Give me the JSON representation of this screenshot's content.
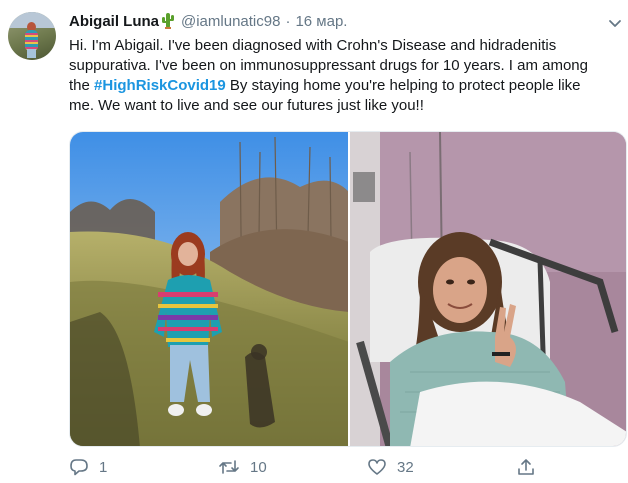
{
  "tweet": {
    "author_name": "Abigail Luna",
    "author_emoji": "cactus-emoji",
    "handle": "@iamlunatic98",
    "separator": "·",
    "date": "16 мар.",
    "text_before_hashtag": "Hi. I'm Abigail. I've been diagnosed with Crohn's Disease and hidradenitis suppurativa. I've been on immunosuppressant drugs for 10 years. I am among the ",
    "hashtag": "#HighRiskCovid19",
    "text_after_hashtag": " By staying home you're helping to protect people like me. We want to live and see our futures just like you!!",
    "photos": [
      {
        "description_icon": "photo-outdoor"
      },
      {
        "description_icon": "photo-hospital"
      }
    ]
  },
  "actions": {
    "reply_count": "1",
    "retweet_count": "10",
    "like_count": "32"
  },
  "colors": {
    "text": "#14171a",
    "secondary": "#657786",
    "link": "#1b95e0"
  },
  "icons": [
    "caret-down-icon",
    "reply-icon",
    "retweet-icon",
    "like-icon",
    "share-icon"
  ]
}
